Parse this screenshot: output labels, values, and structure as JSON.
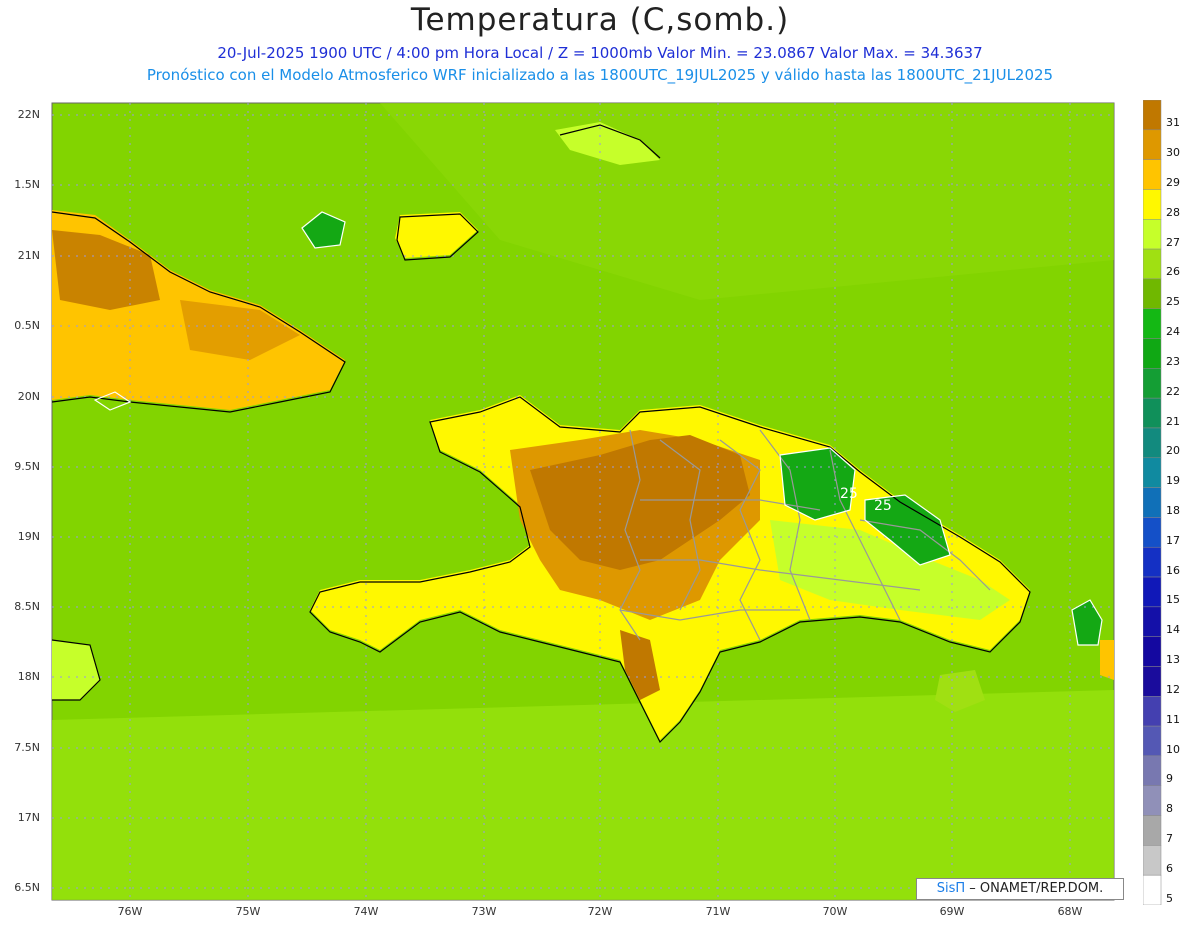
{
  "title": "Temperatura (C,somb.)",
  "subtitle_1": "20-Jul-2025  1900 UTC / 4:00 pm Hora Local / Z = 1000mb   Valor Min. = 23.0867  Valor Max. = 34.3637",
  "subtitle_2": "Pronóstico con el Modelo Atmosferico WRF inicializado a las 1800UTC_19JUL2025 y válido hasta las  1800UTC_21JUL2025",
  "lat_labels": [
    "22N",
    "1.5N",
    "21N",
    "0.5N",
    "20N",
    "9.5N",
    "19N",
    "8.5N",
    "18N",
    "7.5N",
    "17N",
    "6.5N"
  ],
  "lon_labels": [
    "76W",
    "75W",
    "74W",
    "73W",
    "72W",
    "71W",
    "70W",
    "69W",
    "68W"
  ],
  "contour_labels": [
    "25",
    "25"
  ],
  "credit": {
    "brand": "SisΠ",
    "text": " – ONAMET/REP.DOM."
  },
  "colorbar": {
    "labels": [
      "31",
      "30",
      "29",
      "28",
      "27",
      "26",
      "25",
      "24",
      "23",
      "22",
      "21",
      "20",
      "19",
      "18",
      "17",
      "16",
      "15",
      "14",
      "13",
      "12",
      "11",
      "10",
      "9",
      "8",
      "7",
      "6",
      "5"
    ],
    "colors": [
      "#c07800",
      "#de9800",
      "#ffc400",
      "#fff800",
      "#c6ff2a",
      "#a0e012",
      "#70b800",
      "#14b814",
      "#10a814",
      "#149e34",
      "#10905a",
      "#128a7e",
      "#108aa0",
      "#1070b8",
      "#1450c8",
      "#1430c4",
      "#1018b8",
      "#1410a8",
      "#1408a0",
      "#1a0c9c",
      "#4440b0",
      "#5458b4",
      "#7878b0",
      "#9090b8",
      "#a8a8a8",
      "#c8c8c8",
      "#ffffff"
    ]
  },
  "colors": {
    "sea": "#82d400",
    "land_warm": "#c07800",
    "land_mid": "#de9800",
    "land_yellow": "#fff800",
    "land_light": "#c6ff2a",
    "cool_green": "#14a814",
    "border_gray": "#999999",
    "coast": "#000000"
  }
}
